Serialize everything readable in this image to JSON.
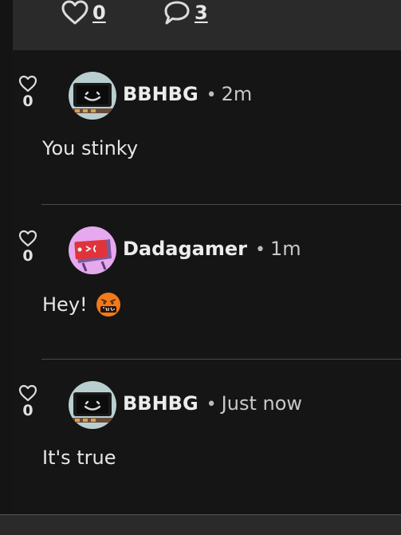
{
  "post": {
    "like_count": "0",
    "comment_count": "3"
  },
  "comments": [
    {
      "username": "BBHBG",
      "separator": "•",
      "time": "2m",
      "text": "You stinky",
      "likes": "0"
    },
    {
      "username": "Dadagamer",
      "separator": "•",
      "time": "1m",
      "text": "Hey!",
      "likes": "0"
    },
    {
      "username": "BBHBG",
      "separator": "•",
      "time": "Just now",
      "text": "It's true",
      "likes": "0"
    }
  ],
  "icons": {
    "like": "heart-outline-icon",
    "comment": "speech-bubble-icon",
    "emoji": "face-with-symbols-on-mouth-emoji"
  },
  "colors": {
    "background": "#151515",
    "post_bar": "#2a2a2a",
    "divider": "#4a4a4a",
    "avatar_teal": "#b9cfcf",
    "avatar_pink": "#e6a8ee",
    "emoji_orange": "#f07a1c"
  }
}
